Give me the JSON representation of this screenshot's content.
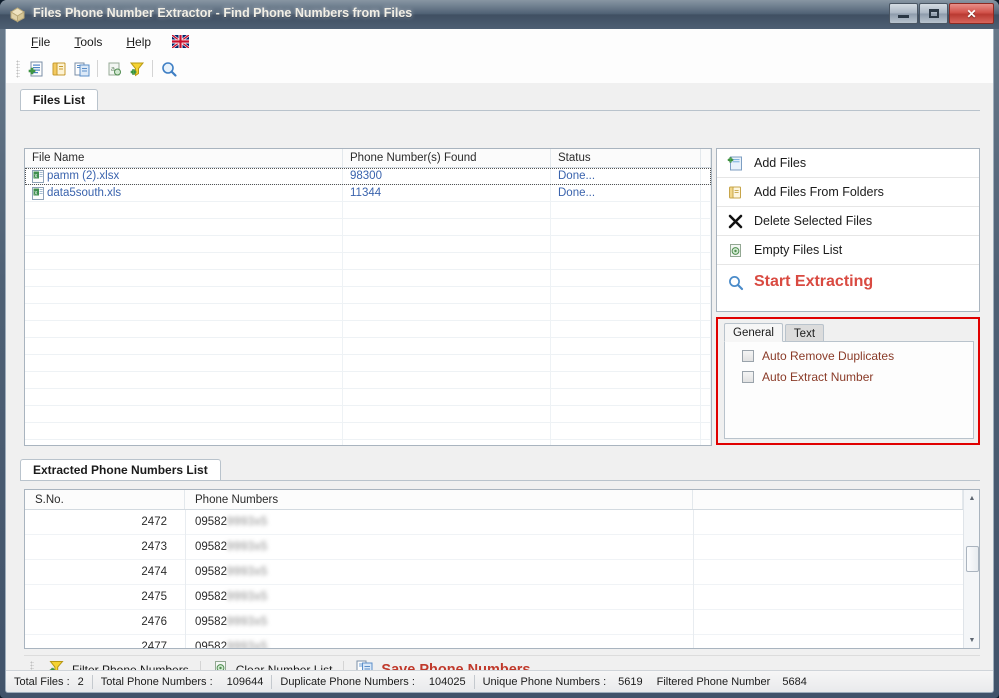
{
  "window": {
    "title": "Files Phone Number Extractor - Find Phone Numbers from Files",
    "app_icon": "package-icon",
    "controls": {
      "minimize": "minimize-button",
      "maximize": "maximize-button",
      "close": "✕"
    }
  },
  "menu": {
    "items": [
      {
        "label": "File",
        "mnemonic": "F"
      },
      {
        "label": "Tools",
        "mnemonic": "T"
      },
      {
        "label": "Help",
        "mnemonic": "H"
      }
    ],
    "language_flag": "uk-flag-icon"
  },
  "toolbar": {
    "buttons": [
      {
        "name": "add-files-icon",
        "tip": "Add Files"
      },
      {
        "name": "add-files-from-folders-icon",
        "tip": "Add Files From Folders"
      },
      {
        "name": "save-phone-numbers-icon",
        "tip": "Save Phone Numbers"
      },
      {
        "name": "clear-number-list-icon",
        "tip": "Clear Number List"
      },
      {
        "name": "filter-phone-numbers-icon",
        "tip": "Filter Phone Numbers"
      },
      {
        "name": "start-extracting-icon",
        "tip": "Start Extracting"
      }
    ]
  },
  "files_tab": {
    "label": "Files List"
  },
  "files_grid": {
    "columns": [
      "File Name",
      "Phone Number(s) Found",
      "Status"
    ],
    "rows": [
      {
        "file_name": "pamm (2).xlsx",
        "numbers_found": "98300",
        "status": "Done...",
        "icon": "excel-file-icon",
        "focused": true
      },
      {
        "file_name": "data5south.xls",
        "numbers_found": "11344",
        "status": "Done...",
        "icon": "excel-file-icon",
        "focused": false
      }
    ],
    "empty_rows": 15
  },
  "actions": [
    {
      "label": "Add Files",
      "icon": "add-files-icon"
    },
    {
      "label": "Add Files From Folders",
      "icon": "folder-icon"
    },
    {
      "label": "Delete Selected Files",
      "icon": "x-cross-icon"
    },
    {
      "label": "Empty Files List",
      "icon": "empty-list-icon"
    },
    {
      "label": "Start Extracting",
      "icon": "magnifier-icon"
    }
  ],
  "options": {
    "tabs": [
      {
        "label": "General",
        "active": true
      },
      {
        "label": "Text",
        "active": false
      }
    ],
    "checkboxes": [
      {
        "label": "Auto Remove Duplicates",
        "checked": false
      },
      {
        "label": "Auto Extract Number",
        "checked": false
      }
    ],
    "highlight_color": "#e00000",
    "label_color": "#8a3b28"
  },
  "extracted_tab": {
    "label": "Extracted Phone Numbers List"
  },
  "numbers_grid": {
    "columns": [
      "S.No.",
      "Phone Numbers",
      ""
    ],
    "rows": [
      {
        "sno": "2472",
        "prefix": "09582",
        "masked": "9993x5"
      },
      {
        "sno": "2473",
        "prefix": "09582",
        "masked": "9993x5"
      },
      {
        "sno": "2474",
        "prefix": "09582",
        "masked": "9993x5"
      },
      {
        "sno": "2475",
        "prefix": "09582",
        "masked": "9993x5"
      },
      {
        "sno": "2476",
        "prefix": "09582",
        "masked": "9993x5"
      }
    ],
    "scrollbar": {
      "up": "▲",
      "down": "▼"
    }
  },
  "bottom_toolbar": {
    "buttons": [
      {
        "label": "Filter Phone Numbers",
        "icon": "filter-phone-numbers-icon",
        "strong": false
      },
      {
        "label": "Clear Number List",
        "icon": "clear-number-list-icon",
        "strong": false
      },
      {
        "label": "Save Phone Numbers",
        "icon": "save-phone-numbers-icon",
        "strong": true
      }
    ]
  },
  "status_bar": {
    "total_files_label": "Total Files :",
    "total_files_value": "2",
    "total_numbers_label": "Total Phone Numbers :",
    "total_numbers_value": "109644",
    "duplicate_label": "Duplicate Phone Numbers :",
    "duplicate_value": "104025",
    "unique_label": "Unique Phone Numbers :",
    "unique_value": "5619",
    "filtered_label": "Filtered Phone Number",
    "filtered_value": "5684"
  },
  "colors": {
    "accent_red": "#c0392b",
    "start_red": "#d94a41",
    "grid_link": "#3a63ad",
    "highlight": "#e00000"
  }
}
